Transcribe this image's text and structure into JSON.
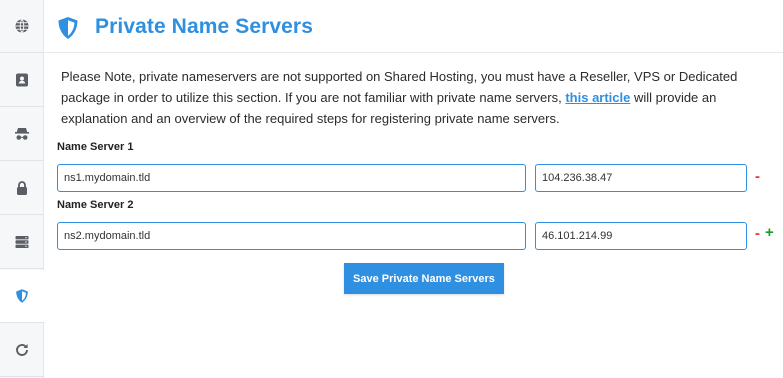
{
  "colors": {
    "accent": "#2f8fe0",
    "remove": "#e23b3b",
    "add": "#1d9a2b"
  },
  "sidebar": {
    "items": [
      {
        "icon": "globe-icon",
        "active": false
      },
      {
        "icon": "contact-card-icon",
        "active": false
      },
      {
        "icon": "incognito-icon",
        "active": false
      },
      {
        "icon": "lock-icon",
        "active": false
      },
      {
        "icon": "server-icon",
        "active": false
      },
      {
        "icon": "shield-icon",
        "active": true
      },
      {
        "icon": "refresh-icon",
        "active": false
      }
    ]
  },
  "header": {
    "title": "Private Name Servers",
    "icon": "shield-icon"
  },
  "notice": {
    "before_link": "Please Note, private nameservers are not supported on Shared Hosting, you must have a Reseller, VPS or Dedicated package in order to utilize this section. If you are not familiar with private name servers, ",
    "link_text": "this article",
    "after_link": " will provide an explanation and an overview of the required steps for registering private name servers."
  },
  "name_servers": [
    {
      "label": "Name Server 1",
      "hostname": "ns1.mydomain.tld",
      "ip": "104.236.38.47",
      "controls": [
        "-"
      ]
    },
    {
      "label": "Name Server 2",
      "hostname": "ns2.mydomain.tld",
      "ip": "46.101.214.99",
      "controls": [
        "-",
        "+"
      ]
    }
  ],
  "save_button": {
    "label": "Save Private Name Servers"
  }
}
